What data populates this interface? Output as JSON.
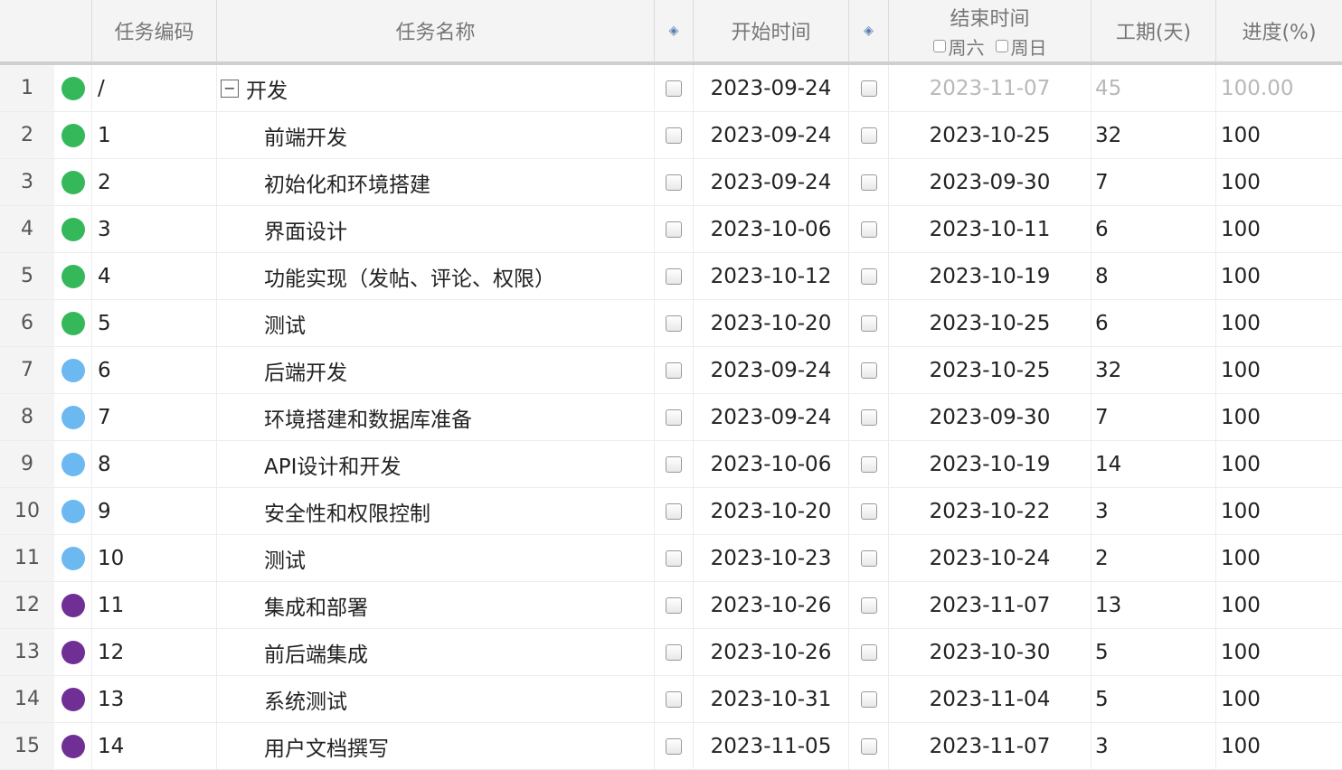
{
  "header": {
    "code": "任务编码",
    "name": "任务名称",
    "diamond1": "◈",
    "start": "开始时间",
    "diamond2": "◈",
    "end": "结束时间",
    "saturday": "周六",
    "sunday": "周日",
    "duration": "工期(天)",
    "progress": "进度(%)"
  },
  "colors": {
    "green": "#35b85a",
    "blue": "#6cb8f0",
    "purple": "#6f2f94"
  },
  "rows": [
    {
      "rn": "1",
      "status": "green",
      "code": "/",
      "name": "开发",
      "group": true,
      "start": "2023-09-24",
      "end": "2023-11-07",
      "duration": "45",
      "progress": "100.00"
    },
    {
      "rn": "2",
      "status": "green",
      "code": "1",
      "name": "前端开发",
      "start": "2023-09-24",
      "end": "2023-10-25",
      "duration": "32",
      "progress": "100"
    },
    {
      "rn": "3",
      "status": "green",
      "code": "2",
      "name": "初始化和环境搭建",
      "start": "2023-09-24",
      "end": "2023-09-30",
      "duration": "7",
      "progress": "100"
    },
    {
      "rn": "4",
      "status": "green",
      "code": "3",
      "name": "界面设计",
      "start": "2023-10-06",
      "end": "2023-10-11",
      "duration": "6",
      "progress": "100"
    },
    {
      "rn": "5",
      "status": "green",
      "code": "4",
      "name": "功能实现（发帖、评论、权限）",
      "start": "2023-10-12",
      "end": "2023-10-19",
      "duration": "8",
      "progress": "100"
    },
    {
      "rn": "6",
      "status": "green",
      "code": "5",
      "name": "测试",
      "start": "2023-10-20",
      "end": "2023-10-25",
      "duration": "6",
      "progress": "100"
    },
    {
      "rn": "7",
      "status": "blue",
      "code": "6",
      "name": "后端开发",
      "start": "2023-09-24",
      "end": "2023-10-25",
      "duration": "32",
      "progress": "100"
    },
    {
      "rn": "8",
      "status": "blue",
      "code": "7",
      "name": "环境搭建和数据库准备",
      "start": "2023-09-24",
      "end": "2023-09-30",
      "duration": "7",
      "progress": "100"
    },
    {
      "rn": "9",
      "status": "blue",
      "code": "8",
      "name": "API设计和开发",
      "start": "2023-10-06",
      "end": "2023-10-19",
      "duration": "14",
      "progress": "100"
    },
    {
      "rn": "10",
      "status": "blue",
      "code": "9",
      "name": "安全性和权限控制",
      "start": "2023-10-20",
      "end": "2023-10-22",
      "duration": "3",
      "progress": "100"
    },
    {
      "rn": "11",
      "status": "blue",
      "code": "10",
      "name": "测试",
      "start": "2023-10-23",
      "end": "2023-10-24",
      "duration": "2",
      "progress": "100"
    },
    {
      "rn": "12",
      "status": "purple",
      "code": "11",
      "name": "集成和部署",
      "start": "2023-10-26",
      "end": "2023-11-07",
      "duration": "13",
      "progress": "100"
    },
    {
      "rn": "13",
      "status": "purple",
      "code": "12",
      "name": "前后端集成",
      "start": "2023-10-26",
      "end": "2023-10-30",
      "duration": "5",
      "progress": "100"
    },
    {
      "rn": "14",
      "status": "purple",
      "code": "13",
      "name": "系统测试",
      "start": "2023-10-31",
      "end": "2023-11-04",
      "duration": "5",
      "progress": "100"
    },
    {
      "rn": "15",
      "status": "purple",
      "code": "14",
      "name": "用户文档撰写",
      "start": "2023-11-05",
      "end": "2023-11-07",
      "duration": "3",
      "progress": "100"
    }
  ]
}
